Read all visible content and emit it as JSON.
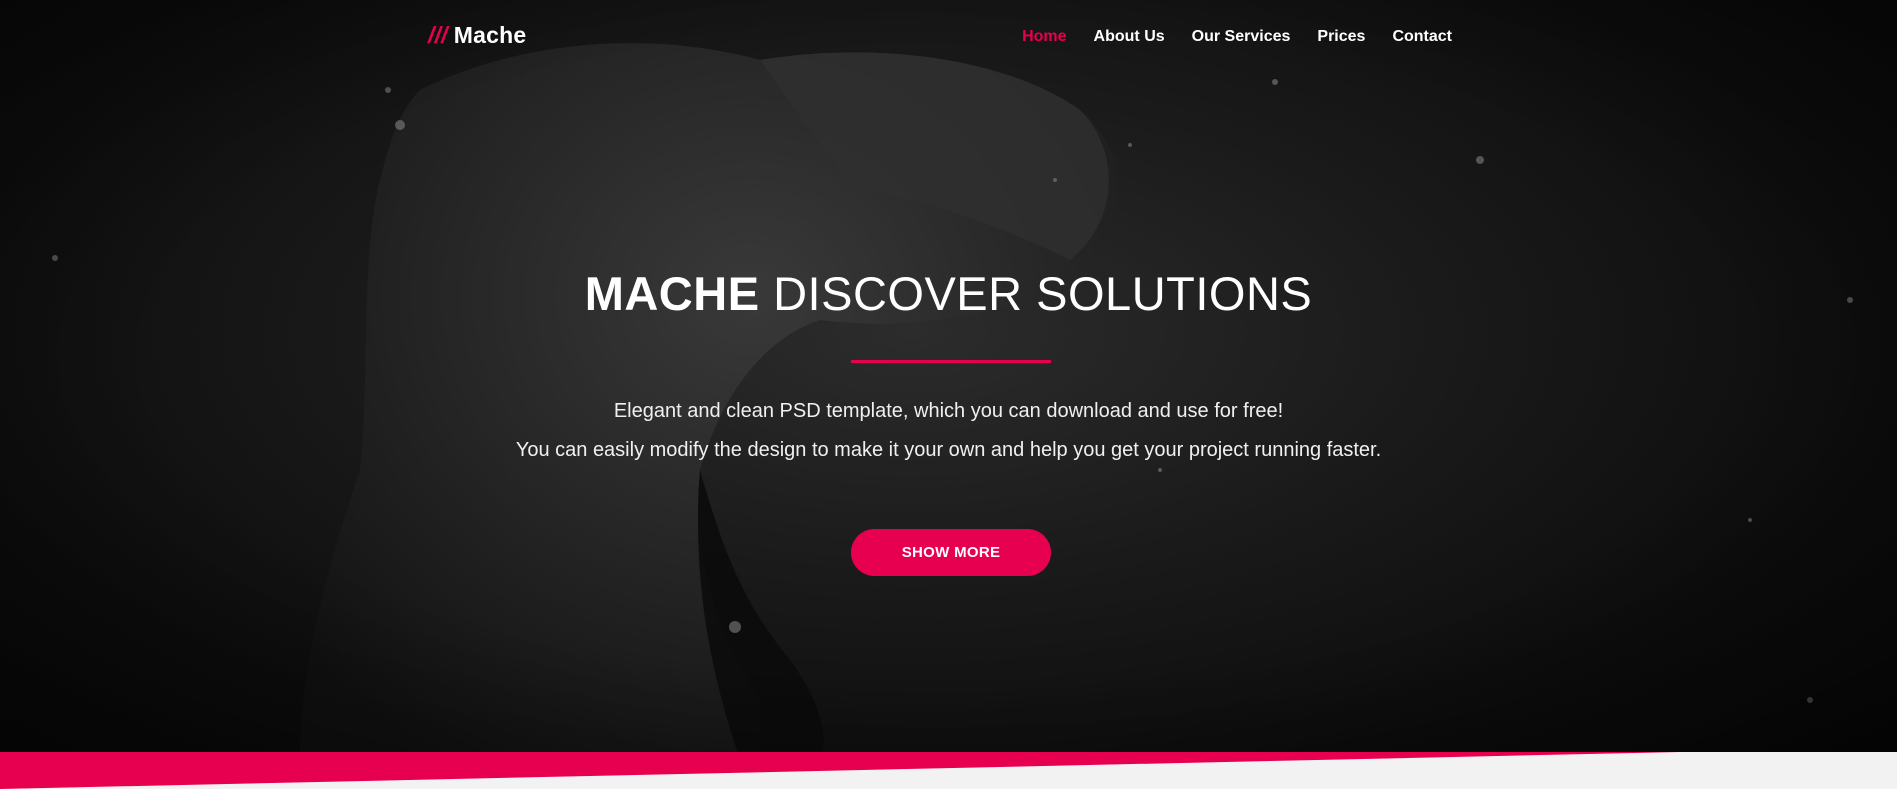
{
  "brand": {
    "slashes": "///",
    "name": "Mache"
  },
  "nav": {
    "items": [
      {
        "label": "Home",
        "active": true
      },
      {
        "label": "About Us",
        "active": false
      },
      {
        "label": "Our Services",
        "active": false
      },
      {
        "label": "Prices",
        "active": false
      },
      {
        "label": "Contact",
        "active": false
      }
    ]
  },
  "hero": {
    "title_strong": "MACHE",
    "title_light": "DISCOVER SOLUTIONS",
    "subtitle_line1": "Elegant and clean PSD template, which you can download and use for free!",
    "subtitle_line2": "You can easily modify the design to make it your own and help you get your project running faster.",
    "cta_label": "SHOW MORE"
  },
  "colors": {
    "accent": "#e6004f",
    "background_dark": "#0d0d0d",
    "text_light": "#ffffff",
    "section_light": "#f2f2f2"
  }
}
